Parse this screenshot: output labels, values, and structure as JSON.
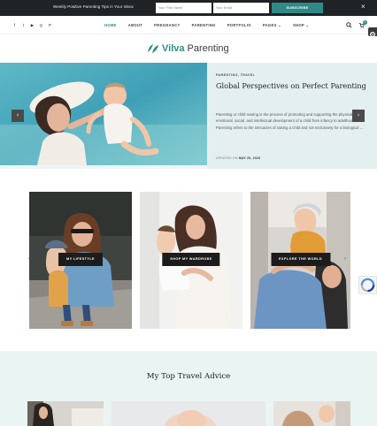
{
  "topbar": {
    "tagline": "Weekly Positive Parenting Tips in Your Inbox",
    "first_name_placeholder": "Your First Name",
    "email_placeholder": "Your Email",
    "subscribe_label": "SUBSCRIBE",
    "close_glyph": "×"
  },
  "social": [
    {
      "icon": "facebook-icon",
      "glyph": "f"
    },
    {
      "icon": "twitter-icon",
      "glyph": "t"
    },
    {
      "icon": "youtube-icon",
      "glyph": "▶"
    },
    {
      "icon": "instagram-icon",
      "glyph": "◎"
    },
    {
      "icon": "pinterest-icon",
      "glyph": "P"
    }
  ],
  "nav": {
    "items": [
      "HOME",
      "ABOUT",
      "PREGNANCY",
      "PARENTING",
      "PORTFOLIO",
      "PAGES ⌄",
      "SHOP ⌄"
    ],
    "active_index": 0,
    "cart_count": "0"
  },
  "logo": {
    "text_brand": "Vilva",
    "text_rest": " Parenting"
  },
  "hero": {
    "categories": "PARENTING, TRAVEL",
    "title": "Global Perspectives on Perfect Parenting",
    "excerpt": "Parenting or child rearing is the process of promoting and supporting the physical, emotional, social, and intellectual development of a child from infancy to adulthood. Parenting refers to the intricacies of raising a child and not exclusively for a biological ...",
    "updated_label": "UPDATED ON",
    "updated_date": "MAY 29, 2023",
    "prev_glyph": "‹",
    "next_glyph": "›"
  },
  "promos": [
    {
      "label": "MY LIFESTYLE"
    },
    {
      "label": "SHOP MY WARDROBE"
    },
    {
      "label": "EXPLORE THE WORLD"
    }
  ],
  "travel": {
    "heading": "My Top Travel Advice"
  },
  "colors": {
    "accent": "#2f8a87",
    "topbar_bg": "#1f2326",
    "hero_panel": "#e4f0ef",
    "section_bg": "#eaf4f3"
  }
}
